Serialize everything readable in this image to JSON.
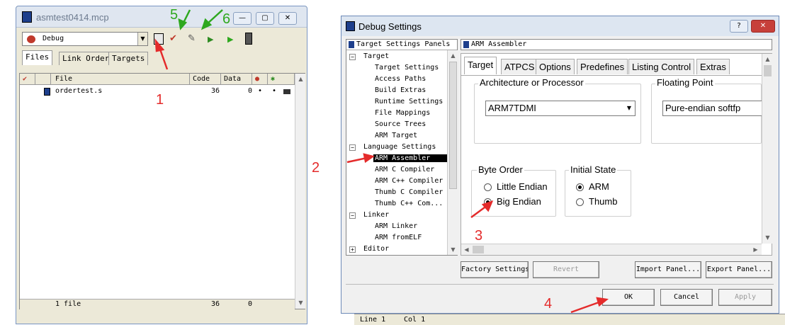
{
  "project_window": {
    "title": "asmtest0414.mcp",
    "target_select": "Debug",
    "tabs": [
      "Files",
      "Link Order",
      "Targets"
    ],
    "columns": [
      "File",
      "Code",
      "Data"
    ],
    "rows": [
      {
        "file": "ordertest.s",
        "code": "36",
        "data": "0",
        "mark1": "•",
        "mark2": "•"
      }
    ],
    "footer": {
      "file_count": "1 file",
      "code": "36",
      "data": "0"
    }
  },
  "annotations": {
    "n1": "1",
    "n2": "2",
    "n3": "3",
    "n4": "4",
    "n5": "5",
    "n6": "6"
  },
  "debug_dialog": {
    "title": "Debug Settings",
    "tree_header": "Target Settings Panels",
    "panel_header": "ARM Assembler",
    "tree": [
      {
        "label": "Target",
        "level": 0
      },
      {
        "label": "Target Settings",
        "level": 1
      },
      {
        "label": "Access Paths",
        "level": 1
      },
      {
        "label": "Build Extras",
        "level": 1
      },
      {
        "label": "Runtime Settings",
        "level": 1
      },
      {
        "label": "File Mappings",
        "level": 1
      },
      {
        "label": "Source Trees",
        "level": 1
      },
      {
        "label": "ARM Target",
        "level": 1
      },
      {
        "label": "Language Settings",
        "level": 0
      },
      {
        "label": "ARM Assembler",
        "level": 1
      },
      {
        "label": "ARM C Compiler",
        "level": 1
      },
      {
        "label": "ARM C++ Compiler",
        "level": 1
      },
      {
        "label": "Thumb C Compiler",
        "level": 1
      },
      {
        "label": "Thumb C++ Com...",
        "level": 1
      },
      {
        "label": "Linker",
        "level": 0
      },
      {
        "label": "ARM Linker",
        "level": 1
      },
      {
        "label": "ARM fromELF",
        "level": 1
      },
      {
        "label": "Editor",
        "level": 0
      }
    ],
    "tabs": [
      "Target",
      "ATPCS",
      "Options",
      "Predefines",
      "Listing Control",
      "Extras"
    ],
    "arch_group": "Architecture or Processor",
    "arch_value": "ARM7TDMI",
    "float_group": "Floating Point",
    "float_value": "Pure-endian softfp",
    "byte_order_group": "Byte Order",
    "byte_order_options": [
      "Little Endian",
      "Big Endian"
    ],
    "initial_state_group": "Initial State",
    "initial_state_options": [
      "ARM",
      "Thumb"
    ],
    "buttons": {
      "factory": "Factory Settings",
      "revert": "Revert",
      "import": "Import Panel...",
      "export": "Export Panel...",
      "ok": "OK",
      "cancel": "Cancel",
      "apply": "Apply"
    }
  },
  "status_fragment": {
    "line": "Line 1",
    "col": "Col 1"
  }
}
